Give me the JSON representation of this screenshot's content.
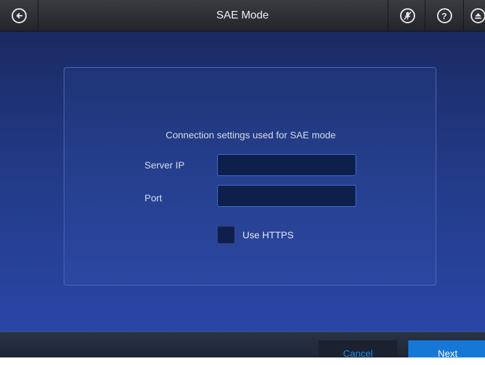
{
  "header": {
    "title": "SAE Mode",
    "back_icon": "back-arrow-icon",
    "mic_icon": "mute-microphone-icon",
    "help_icon": "help-icon",
    "eject_icon": "eject-icon"
  },
  "panel": {
    "heading": "Connection settings used for SAE mode",
    "server_ip_label": "Server IP",
    "server_ip_value": "",
    "port_label": "Port",
    "port_value": "",
    "https_label": "Use HTTPS",
    "https_checked": false
  },
  "footer": {
    "cancel_label": "Cancel",
    "next_label": "Next"
  },
  "colors": {
    "accent": "#1577d6",
    "cancel_text": "#1d8fe8",
    "background": "#223a86"
  }
}
